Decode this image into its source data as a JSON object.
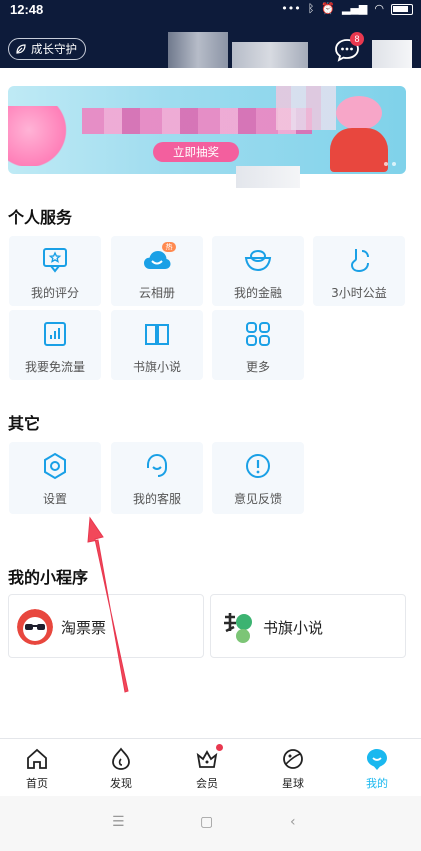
{
  "status_bar": {
    "time": "12:48"
  },
  "header": {
    "guard_button": "成长守护",
    "message_count": "8"
  },
  "banner": {
    "button": "立即抽奖"
  },
  "personal_services": {
    "title": "个人服务",
    "items": [
      {
        "label": "我的评分",
        "icon": "rating-icon"
      },
      {
        "label": "云相册",
        "icon": "cloud-album-icon",
        "badge": "热"
      },
      {
        "label": "我的金融",
        "icon": "finance-ingot-icon"
      },
      {
        "label": "3小时公益",
        "icon": "charity-icon"
      },
      {
        "label": "我要免流量",
        "icon": "data-flow-icon"
      },
      {
        "label": "书旗小说",
        "icon": "book-icon"
      },
      {
        "label": "更多",
        "icon": "more-grid-icon"
      }
    ]
  },
  "others": {
    "title": "其它",
    "items": [
      {
        "label": "设置",
        "icon": "settings-icon"
      },
      {
        "label": "我的客服",
        "icon": "customer-service-icon"
      },
      {
        "label": "意见反馈",
        "icon": "feedback-icon"
      }
    ]
  },
  "mini_programs": {
    "title": "我的小程序",
    "items": [
      {
        "label": "淘票票",
        "icon": "taopiaopiao-logo"
      },
      {
        "label": "书旗小说",
        "icon": "shuqi-logo"
      }
    ]
  },
  "tab_bar": {
    "items": [
      {
        "label": "首页",
        "icon": "home-icon"
      },
      {
        "label": "发现",
        "icon": "discover-icon"
      },
      {
        "label": "会员",
        "icon": "vip-crown-icon"
      },
      {
        "label": "星球",
        "icon": "planet-icon"
      },
      {
        "label": "我的",
        "icon": "profile-icon",
        "active": true
      }
    ]
  },
  "colors": {
    "header_bg": "#0d1b3a",
    "accent": "#1ab8ef",
    "badge": "#e8384f",
    "card_bg": "#f4f8fc",
    "arrow": "#f2485a"
  }
}
